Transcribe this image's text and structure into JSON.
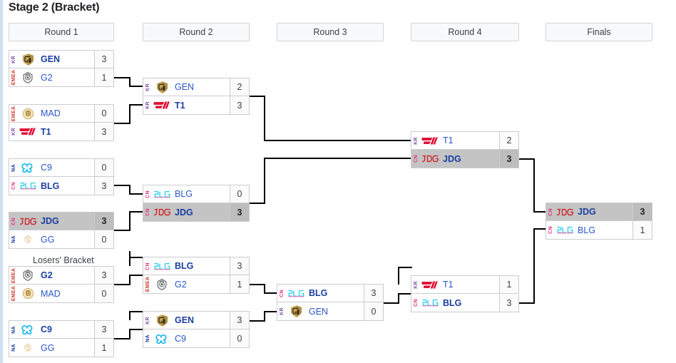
{
  "page": {
    "title": "Stage 2 (Bracket)",
    "losers_bracket_label": "Losers' Bracket"
  },
  "colors": {
    "winner_row_bg": "#c4c4c4",
    "header_bg": "#f8f9fa",
    "border": "#c9ccd0",
    "team_text": "#2b57c9",
    "region_KR": "#7e4fa8",
    "region_EMEA": "#d43b2f",
    "region_NA": "#1a3fa0",
    "region_CN": "#e8357f",
    "left_rail": "#cfe2f3"
  },
  "rounds": [
    {
      "label": "Round 1"
    },
    {
      "label": "Round 2"
    },
    {
      "label": "Round 3"
    },
    {
      "label": "Round 4"
    },
    {
      "label": "Finals"
    }
  ],
  "matches": [
    {
      "id": "r1m1",
      "round": "Round 1",
      "teams": [
        {
          "region": "KR",
          "logo": "gen-logo",
          "name": "GEN",
          "score": "3",
          "winner": true
        },
        {
          "region": "EMEA",
          "logo": "g2-logo",
          "name": "G2",
          "score": "1",
          "winner": false
        }
      ]
    },
    {
      "id": "r1m2",
      "round": "Round 1",
      "teams": [
        {
          "region": "EMEA",
          "logo": "mad-logo",
          "name": "MAD",
          "score": "0",
          "winner": false
        },
        {
          "region": "KR",
          "logo": "t1-logo",
          "name": "T1",
          "score": "3",
          "winner": true
        }
      ]
    },
    {
      "id": "r1m3",
      "round": "Round 1",
      "teams": [
        {
          "region": "NA",
          "logo": "c9-logo",
          "name": "C9",
          "score": "0",
          "winner": false
        },
        {
          "region": "CN",
          "logo": "blg-logo",
          "name": "BLG",
          "score": "3",
          "winner": true
        }
      ]
    },
    {
      "id": "r1m4",
      "round": "Round 1",
      "teams": [
        {
          "region": "CN",
          "logo": "jdg-logo",
          "name": "JDG",
          "score": "3",
          "winner": true,
          "highlight": true
        },
        {
          "region": "NA",
          "logo": "gg-logo",
          "name": "GG",
          "score": "0",
          "winner": false
        }
      ]
    },
    {
      "id": "r1m5",
      "round": "Round 1",
      "bracket": "Losers' Bracket",
      "teams": [
        {
          "region": "EMEA",
          "logo": "g2-logo",
          "name": "G2",
          "score": "3",
          "winner": true
        },
        {
          "region": "EMEA",
          "logo": "mad-logo",
          "name": "MAD",
          "score": "0",
          "winner": false
        }
      ]
    },
    {
      "id": "r1m6",
      "round": "Round 1",
      "bracket": "Losers' Bracket",
      "teams": [
        {
          "region": "NA",
          "logo": "c9-logo",
          "name": "C9",
          "score": "3",
          "winner": true
        },
        {
          "region": "NA",
          "logo": "gg-logo",
          "name": "GG",
          "score": "1",
          "winner": false
        }
      ]
    },
    {
      "id": "r2m1",
      "round": "Round 2",
      "teams": [
        {
          "region": "KR",
          "logo": "gen-logo",
          "name": "GEN",
          "score": "2",
          "winner": false
        },
        {
          "region": "KR",
          "logo": "t1-logo",
          "name": "T1",
          "score": "3",
          "winner": true
        }
      ]
    },
    {
      "id": "r2m2",
      "round": "Round 2",
      "teams": [
        {
          "region": "CN",
          "logo": "blg-logo",
          "name": "BLG",
          "score": "0",
          "winner": false
        },
        {
          "region": "CN",
          "logo": "jdg-logo",
          "name": "JDG",
          "score": "3",
          "winner": true,
          "highlight": true
        }
      ]
    },
    {
      "id": "r2m3",
      "round": "Round 2",
      "bracket": "Losers' Bracket",
      "teams": [
        {
          "region": "CN",
          "logo": "blg-logo",
          "name": "BLG",
          "score": "3",
          "winner": true
        },
        {
          "region": "EMEA",
          "logo": "g2-logo",
          "name": "G2",
          "score": "1",
          "winner": false
        }
      ]
    },
    {
      "id": "r2m4",
      "round": "Round 2",
      "bracket": "Losers' Bracket",
      "teams": [
        {
          "region": "KR",
          "logo": "gen-logo",
          "name": "GEN",
          "score": "3",
          "winner": true
        },
        {
          "region": "NA",
          "logo": "c9-logo",
          "name": "C9",
          "score": "0",
          "winner": false
        }
      ]
    },
    {
      "id": "r3m1",
      "round": "Round 3",
      "teams": [
        {
          "region": "CN",
          "logo": "blg-logo",
          "name": "BLG",
          "score": "3",
          "winner": true
        },
        {
          "region": "KR",
          "logo": "gen-logo",
          "name": "GEN",
          "score": "0",
          "winner": false
        }
      ]
    },
    {
      "id": "r4m1",
      "round": "Round 4",
      "teams": [
        {
          "region": "KR",
          "logo": "t1-logo",
          "name": "T1",
          "score": "2",
          "winner": false
        },
        {
          "region": "CN",
          "logo": "jdg-logo",
          "name": "JDG",
          "score": "3",
          "winner": true,
          "highlight": true
        }
      ]
    },
    {
      "id": "r4m2",
      "round": "Round 4",
      "teams": [
        {
          "region": "KR",
          "logo": "t1-logo",
          "name": "T1",
          "score": "1",
          "winner": false
        },
        {
          "region": "CN",
          "logo": "blg-logo",
          "name": "BLG",
          "score": "3",
          "winner": true
        }
      ]
    },
    {
      "id": "fm1",
      "round": "Finals",
      "teams": [
        {
          "region": "CN",
          "logo": "jdg-logo",
          "name": "JDG",
          "score": "3",
          "winner": true,
          "highlight": true
        },
        {
          "region": "CN",
          "logo": "blg-logo",
          "name": "BLG",
          "score": "1",
          "winner": false
        }
      ]
    }
  ]
}
